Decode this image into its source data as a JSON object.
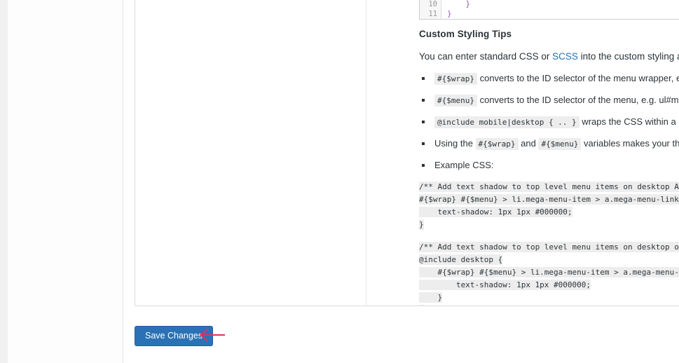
{
  "window": {
    "background": "#ffffff",
    "gutter_color": "#f0f0f1"
  },
  "code_editor": {
    "name": "custom-styling-code-editor",
    "visible_lines": [
      {
        "number": "10",
        "code": "    }"
      },
      {
        "number": "11",
        "code": "}"
      }
    ]
  },
  "docs": {
    "heading": "Custom Styling Tips",
    "intro_before_link": "You can enter standard CSS or ",
    "intro_link": "SCSS",
    "intro_after_link": " into the custom styling area. If using S",
    "tips": [
      {
        "code": "#{$wrap}",
        "text": " converts to the ID selector of the menu wrapper, e.g. div#mega-men"
      },
      {
        "code": "#{$menu}",
        "text": " converts to the ID selector of the menu, e.g. ul#mega-menu-primary"
      },
      {
        "code": "@include mobile|desktop { .. }",
        "text": " wraps the CSS within a media query based"
      },
      {
        "prefix": "Using the ",
        "code": "#{$wrap}",
        "mid": " and ",
        "code2": "#{$menu}",
        "text": " variables makes your theme portable (allo"
      },
      {
        "text": "Example CSS:"
      }
    ],
    "code_block_1": [
      "/** Add text shadow to top level menu items on desktop AND mobile **/",
      "#{$wrap} #{$menu} > li.mega-menu-item > a.mega-menu-link {",
      "    text-shadow: 1px 1px #000000;",
      "}"
    ],
    "code_block_2": [
      "/** Add text shadow to top level menu items on desktop only **/",
      "@include desktop {",
      "    #{$wrap} #{$menu} > li.mega-menu-item > a.mega-menu-link {",
      "        text-shadow: 1px 1px #000000;",
      "    }",
      "}"
    ]
  },
  "actions": {
    "save_label": "Save Changes",
    "save_color": "#2a72b5"
  },
  "annotation": {
    "arrow_color": "#e0315b",
    "arrow_direction": "left"
  }
}
